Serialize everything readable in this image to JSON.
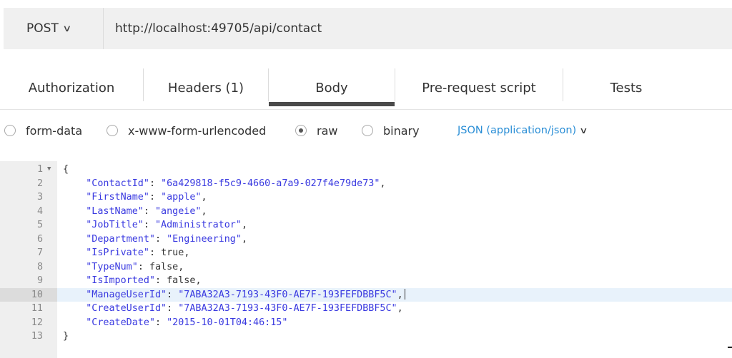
{
  "request": {
    "method": "POST",
    "url": "http://localhost:49705/api/contact"
  },
  "tabs": [
    {
      "label": "Authorization",
      "active": false
    },
    {
      "label": "Headers (1)",
      "active": false
    },
    {
      "label": "Body",
      "active": true
    },
    {
      "label": "Pre-request script",
      "active": false
    },
    {
      "label": "Tests",
      "active": false
    }
  ],
  "body_modes": [
    {
      "label": "form-data",
      "checked": false
    },
    {
      "label": "x-www-form-urlencoded",
      "checked": false
    },
    {
      "label": "raw",
      "checked": true
    },
    {
      "label": "binary",
      "checked": false
    }
  ],
  "content_type": {
    "label": "JSON (application/json)",
    "color": "#2a8ed6"
  },
  "editor": {
    "active_line": 10,
    "lines": [
      {
        "n": "1",
        "text": "{"
      },
      {
        "n": "2",
        "key": "\"ContactId\"",
        "val": "\"6a429818-f5c9-4660-a7a9-027f4e79de73\"",
        "tail": ","
      },
      {
        "n": "3",
        "key": "\"FirstName\"",
        "val": "\"apple\"",
        "tail": ","
      },
      {
        "n": "4",
        "key": "\"LastName\"",
        "val": "\"angeie\"",
        "tail": ","
      },
      {
        "n": "5",
        "key": "\"JobTitle\"",
        "val": "\"Administrator\"",
        "tail": ","
      },
      {
        "n": "6",
        "key": "\"Department\"",
        "val": "\"Engineering\"",
        "tail": ","
      },
      {
        "n": "7",
        "key": "\"IsPrivate\"",
        "lit": "true",
        "tail": ","
      },
      {
        "n": "8",
        "key": "\"TypeNum\"",
        "lit": "false",
        "tail": ","
      },
      {
        "n": "9",
        "key": "\"IsImported\"",
        "lit": "false",
        "tail": ","
      },
      {
        "n": "10",
        "key": "\"ManageUserId\"",
        "val": "\"7ABA32A3-7193-43F0-AE7F-193FEFDBBF5C\"",
        "tail": ","
      },
      {
        "n": "11",
        "key": "\"CreateUserId\"",
        "val": "\"7ABA32A3-7193-43F0-AE7F-193FEFDBBF5C\"",
        "tail": ","
      },
      {
        "n": "12",
        "key": "\"CreateDate\"",
        "val": "\"2015-10-01T04:46:15\"",
        "tail": ""
      },
      {
        "n": "13",
        "text": "}"
      }
    ]
  }
}
